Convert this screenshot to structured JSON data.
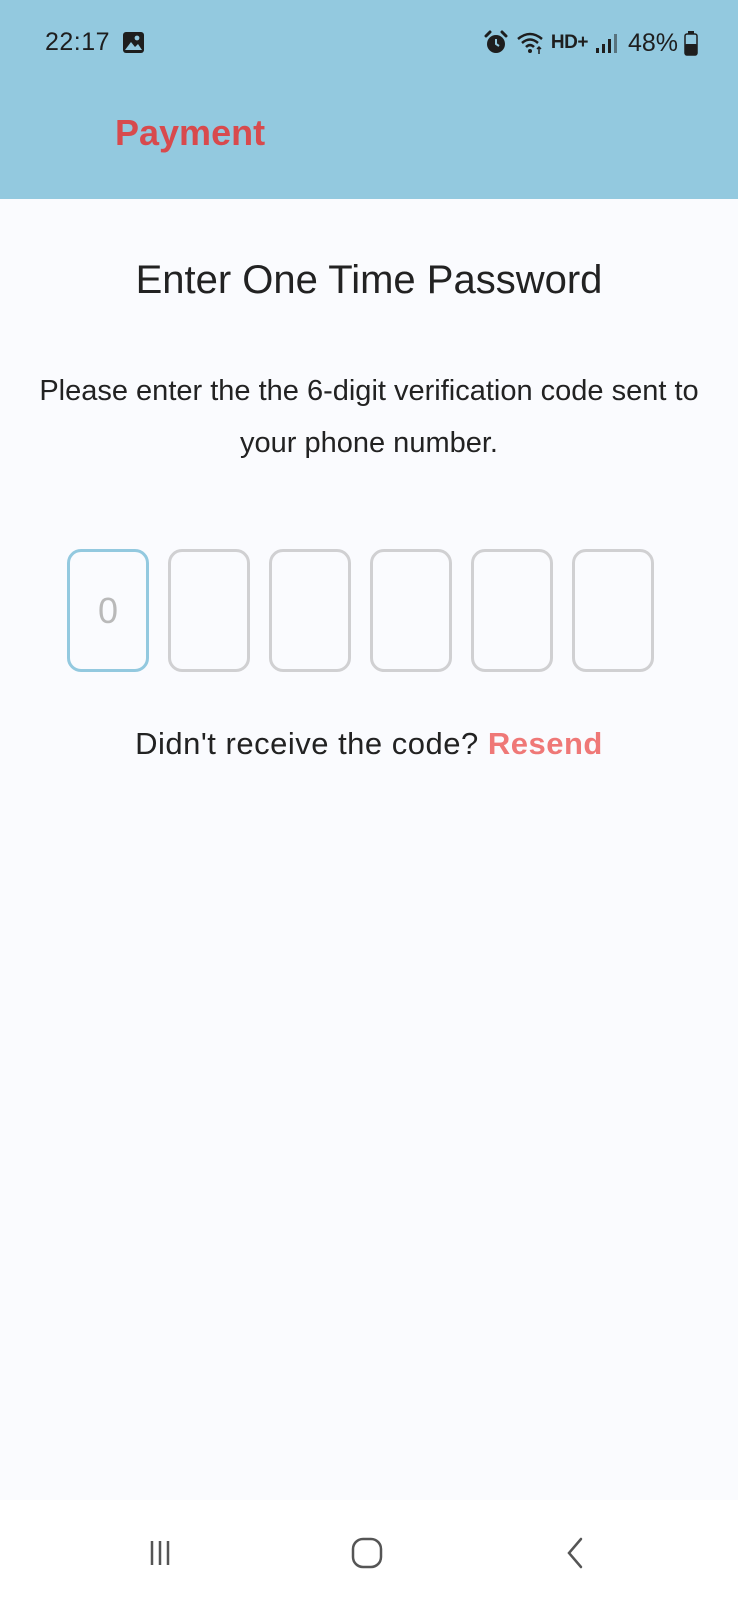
{
  "status_bar": {
    "time": "22:17",
    "network_label": "HD+",
    "battery": "48%"
  },
  "header": {
    "title": "Payment",
    "background_color": "#93c9df",
    "title_color": "#d84a4d"
  },
  "otp": {
    "title": "Enter One Time Password",
    "description": "Please enter the the 6-digit verification code sent to your phone number.",
    "boxes": [
      {
        "value": "0",
        "state": "placeholder-focused"
      },
      {
        "value": ""
      },
      {
        "value": ""
      },
      {
        "value": ""
      },
      {
        "value": ""
      },
      {
        "value": ""
      }
    ],
    "focus_color": "#93c9df"
  },
  "resend": {
    "prompt": "Didn't receive the code?",
    "link": "Resend",
    "link_color": "#ef7877"
  },
  "navbar": {
    "icons": [
      "recent-apps-icon",
      "home-icon",
      "back-icon"
    ]
  }
}
